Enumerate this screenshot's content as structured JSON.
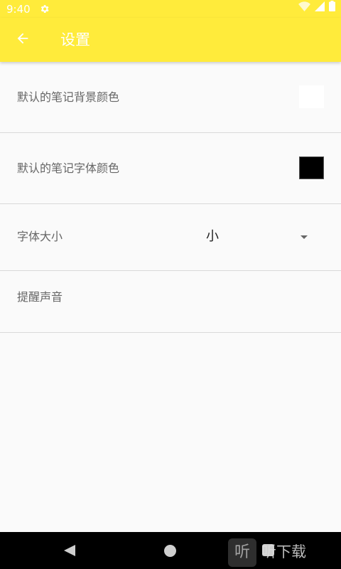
{
  "status_bar": {
    "time": "9:40",
    "settings_icon": "gear-icon",
    "wifi_icon": "wifi-icon",
    "signal_icon": "signal-icon",
    "battery_icon": "battery-icon"
  },
  "toolbar": {
    "back_icon": "arrow-left-icon",
    "title": "设置",
    "background_color": "#ffeb3b"
  },
  "settings": {
    "background_color_label": "默认的笔记背景颜色",
    "background_color_value": "#ffffff",
    "text_color_label": "默认的笔记字体颜色",
    "text_color_value": "#000000",
    "font_size_label": "字体大小",
    "font_size_value": "小",
    "reminder_sound_label": "提醒声音"
  },
  "nav_bar": {
    "back_icon": "triangle-back-icon",
    "home_icon": "circle-home-icon",
    "recent_icon": "square-recent-icon"
  },
  "watermark": {
    "logo_text": "听",
    "text": "听下载"
  }
}
